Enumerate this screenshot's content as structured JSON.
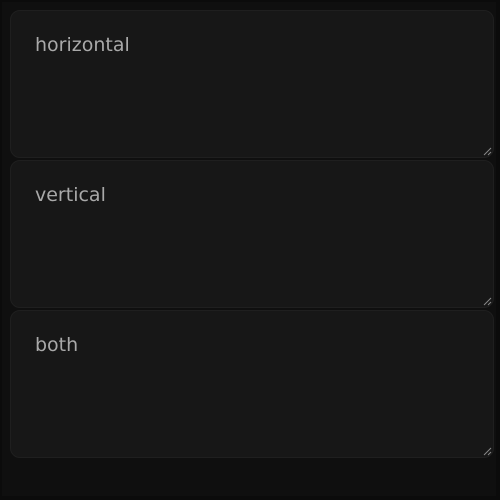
{
  "textareas": [
    {
      "placeholder": "horizontal",
      "value": ""
    },
    {
      "placeholder": "vertical",
      "value": ""
    },
    {
      "placeholder": "both",
      "value": ""
    }
  ],
  "colors": {
    "page_background": "#0b0b0b",
    "frame_background": "#0f0f0f",
    "field_background": "#171717",
    "placeholder_text": "#a9a9a9",
    "grip": "#8a8a8a"
  },
  "icons": {
    "resize_grip": "resize-grip-icon"
  }
}
